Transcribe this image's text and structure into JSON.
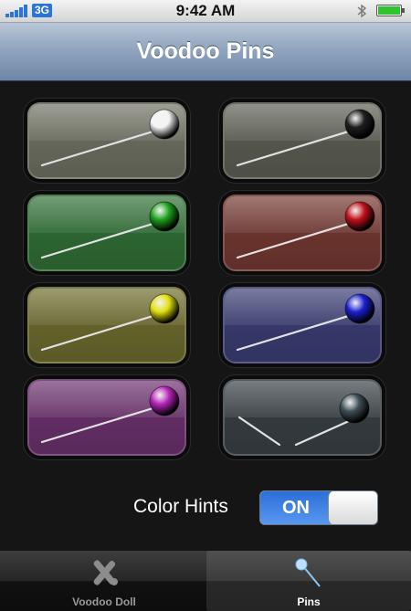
{
  "status_bar": {
    "network": "3G",
    "time": "9:42 AM"
  },
  "nav": {
    "title": "Voodoo Pins"
  },
  "pins": [
    {
      "color_name": "white",
      "tint": "#6f7062",
      "head": "#f4f4f4",
      "broken": false
    },
    {
      "color_name": "black",
      "tint": "#5c5d52",
      "head": "#1e1e1e",
      "broken": false
    },
    {
      "color_name": "green",
      "tint": "#2f6f35",
      "head": "#1fa11f",
      "broken": false
    },
    {
      "color_name": "red",
      "tint": "#743730",
      "head": "#c0111b",
      "broken": false
    },
    {
      "color_name": "yellow",
      "tint": "#6d6b2c",
      "head": "#e1e011",
      "broken": false
    },
    {
      "color_name": "blue",
      "tint": "#393c73",
      "head": "#1c1fd0",
      "broken": false
    },
    {
      "color_name": "purple",
      "tint": "#6b306d",
      "head": "#b624b8",
      "broken": false
    },
    {
      "color_name": "slate",
      "tint": "#373f44",
      "head": "#3f4f56",
      "broken": true
    }
  ],
  "color_hints": {
    "label": "Color Hints",
    "state": "ON"
  },
  "tabs": [
    {
      "label": "Voodoo Doll",
      "icon": "voodoo-doll-icon",
      "selected": false
    },
    {
      "label": "Pins",
      "icon": "pin-icon",
      "selected": true
    }
  ]
}
